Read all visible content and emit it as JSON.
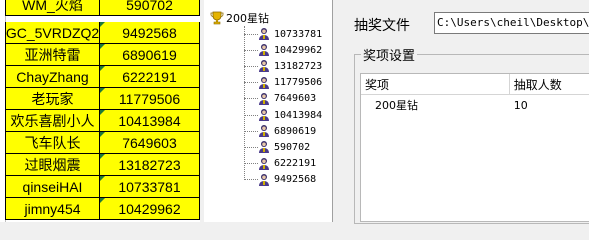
{
  "sheet": {
    "rows": [
      {
        "name": "WM_火焰",
        "id": "590702"
      },
      {
        "name": "GC_5VRDZQ2",
        "id": "9492568"
      },
      {
        "name": "亚洲特雷",
        "id": "6890619"
      },
      {
        "name": "ChayZhang",
        "id": "6222191"
      },
      {
        "name": "老玩家",
        "id": "11779506"
      },
      {
        "name": "欢乐喜剧小人",
        "id": "10413984"
      },
      {
        "name": "飞车队长",
        "id": "7649603"
      },
      {
        "name": "过眼烟震",
        "id": "13182723"
      },
      {
        "name": "qinseiHAI",
        "id": "10733781"
      },
      {
        "name": "jimny454",
        "id": "10429962"
      }
    ],
    "cell_color": "#ffff00"
  },
  "tree": {
    "root_label": "200星钻",
    "root_icon": "trophy-icon",
    "item_icon": "person-icon",
    "items": [
      "10733781",
      "10429962",
      "13182723",
      "11779506",
      "7649603",
      "10413984",
      "6890619",
      "590702",
      "6222191",
      "9492568"
    ]
  },
  "panel": {
    "file_label": "抽奖文件",
    "file_path": "C:\\Users\\cheil\\Desktop\\版",
    "group_title": "奖项设置",
    "table": {
      "headers": [
        "奖项",
        "抽取人数"
      ],
      "rows": [
        {
          "prize": "200星钻",
          "count": "10"
        }
      ]
    }
  }
}
